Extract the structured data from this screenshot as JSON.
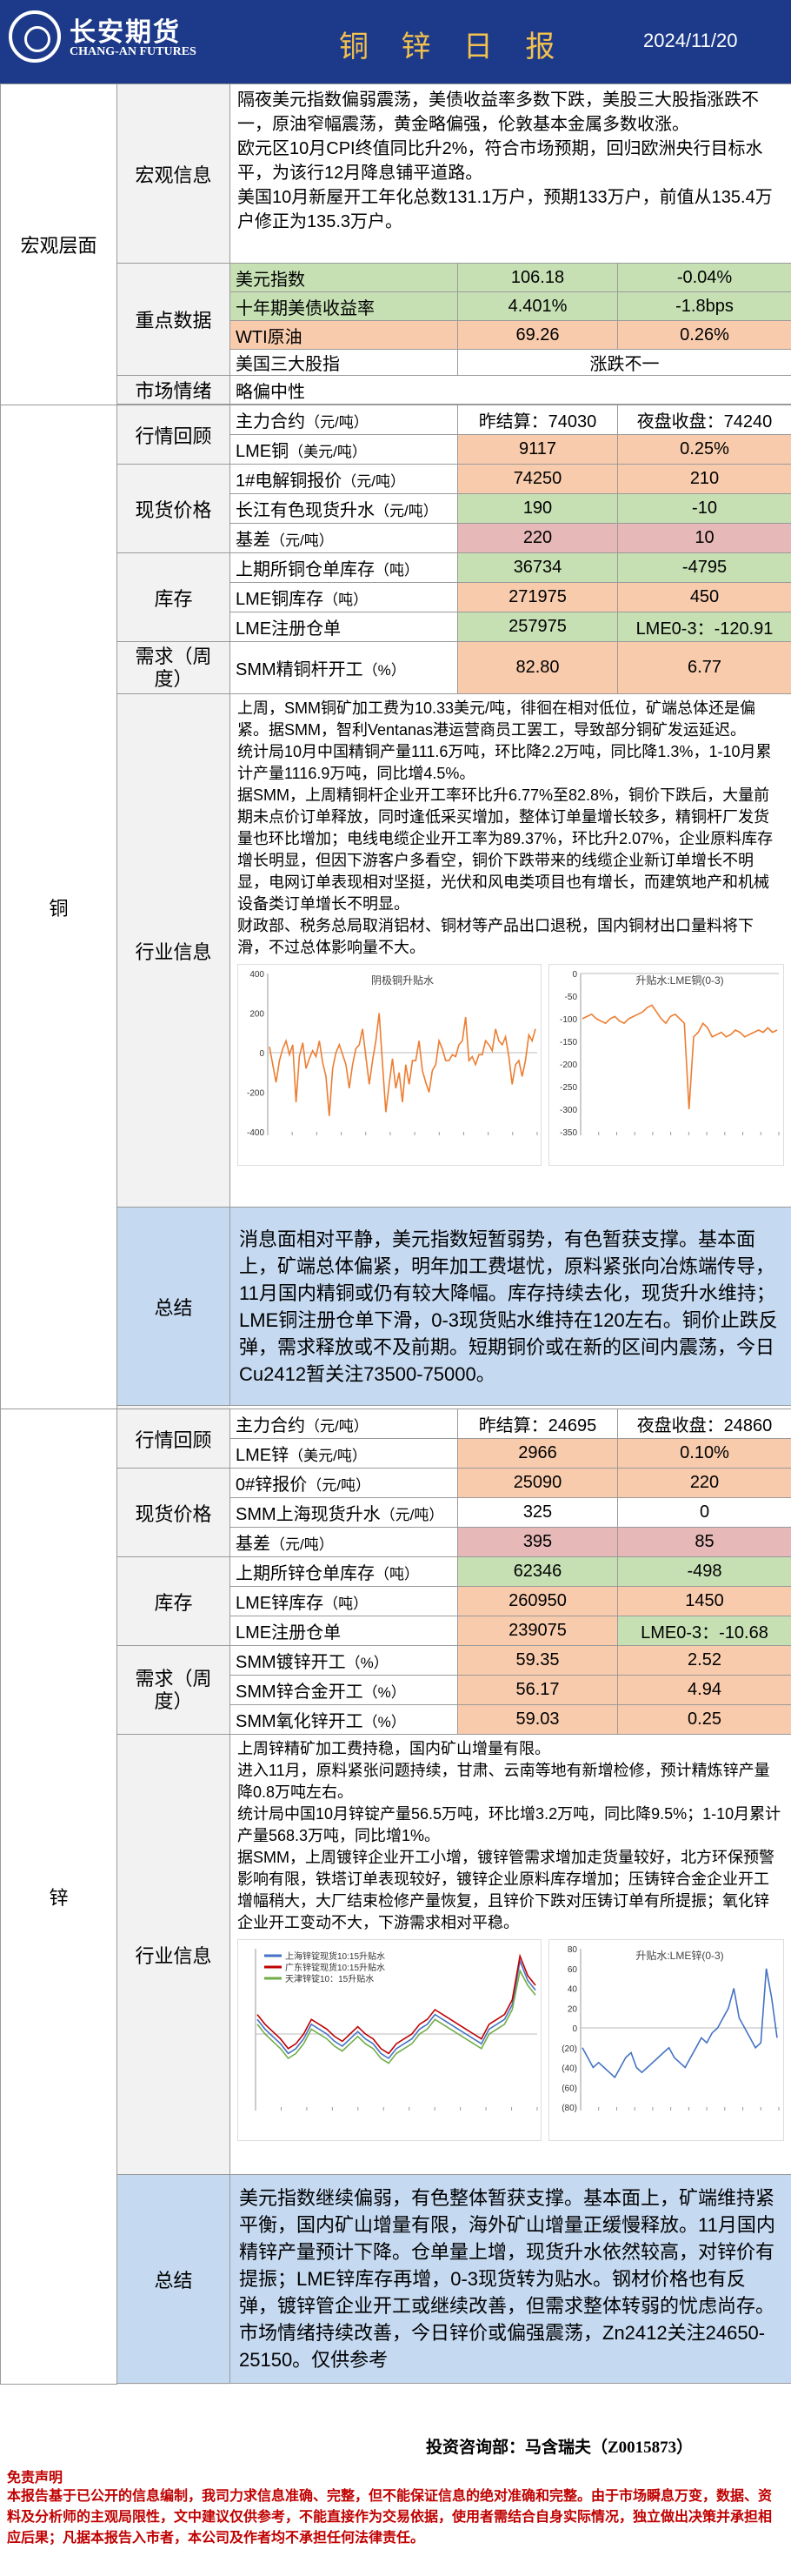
{
  "header": {
    "brand": "长安期货",
    "brand_en": "CHANG-AN FUTURES",
    "title": "铜 锌 日 报",
    "date": "2024/11/20"
  },
  "macro": {
    "section": "宏观层面",
    "info_label": "宏观信息",
    "info": [
      "隔夜美元指数偏弱震荡，美债收益率多数下跌，美股三大股指涨跌不一，原油窄幅震荡，黄金略偏强，伦敦基本金属多数收涨。",
      "欧元区10月CPI终值同比升2%，符合市场预期，回归欧洲央行目标水平，为该行12月降息铺平道路。",
      "美国10月新屋开工年化总数131.1万户，预期133万户，前值从135.4万户修正为135.3万户。"
    ],
    "key_label": "重点数据",
    "key": [
      {
        "name": "美元指数",
        "v1": "106.18",
        "v2": "-0.04%"
      },
      {
        "name": "十年期美债收益率",
        "v1": "4.401%",
        "v2": "-1.8bps"
      },
      {
        "name": "WTI原油",
        "v1": "69.26",
        "v2": "0.26%"
      }
    ],
    "stocks": {
      "name": "美国三大股指",
      "value": "涨跌不一"
    },
    "sentiment_label": "市场情绪",
    "sentiment": "略偏中性"
  },
  "copper": {
    "section": "铜",
    "market_label": "行情回顾",
    "main": {
      "name": "主力合约",
      "unit": "（元/吨）",
      "settle": "昨结算：74030",
      "night": "夜盘收盘：74240"
    },
    "lme": {
      "name": "LME铜",
      "unit": "（美元/吨）",
      "v1": "9117",
      "v2": "0.25%"
    },
    "spot_label": "现货价格",
    "spot": [
      {
        "name": "1#电解铜报价",
        "unit": "（元/吨）",
        "v1": "74250",
        "v2": "210"
      },
      {
        "name": "长江有色现货升水",
        "unit": "（元/吨）",
        "v1": "190",
        "v2": "-10"
      },
      {
        "name": "基差",
        "unit": "（元/吨）",
        "v1": "220",
        "v2": "10"
      }
    ],
    "inv_label": "库存",
    "inv": [
      {
        "name": "上期所铜仓单库存",
        "unit": "（吨）",
        "v1": "36734",
        "v2": "-4795"
      },
      {
        "name": "LME铜库存",
        "unit": "（吨）",
        "v1": "271975",
        "v2": "450"
      },
      {
        "name": "LME注册仓单",
        "unit": "",
        "v1": "257975",
        "v2": "LME0-3：-120.91"
      }
    ],
    "demand_label": "需求（周度）",
    "demand": {
      "name": "SMM精铜杆开工",
      "unit": "（%）",
      "v1": "82.80",
      "v2": "6.77"
    },
    "industry_label": "行业信息",
    "industry": [
      "上周，SMM铜矿加工费为10.33美元/吨，徘徊在相对低位，矿端总体还是偏紧。据SMM，智利Ventanas港运营商员工罢工，导致部分铜矿发运延迟。",
      "统计局10月中国精铜产量111.6万吨，环比降2.2万吨，同比降1.3%，1-10月累计产量1116.9万吨，同比增4.5%。",
      "据SMM，上周精铜杆企业开工率环比升6.77%至82.8%，铜价下跌后，大量前期未点价订单释放，同时逢低采买增加，整体订单量增长较多，精铜杆厂发货量也环比增加；电线电缆企业开工率为89.37%，环比升2.07%，企业原料库存增长明显，但因下游客户多看空，铜价下跌带来的线缆企业新订单增长不明显，电网订单表现相对坚挺，光伏和风电类项目也有增长，而建筑地产和机械设备类订单增长不明显。",
      "财政部、税务总局取消铝材、铜材等产品出口退税，国内铜材出口量料将下滑，不过总体影响量不大。"
    ],
    "chart1_title": "阴极铜升贴水",
    "chart2_title": "升贴水:LME铜(0-3)",
    "summary_label": "总结",
    "summary": "消息面相对平静，美元指数短暂弱势，有色暂获支撑。基本面上，矿端总体偏紧，明年加工费堪忧，原料紧张向冶炼端传导，11月国内精铜或仍有较大降幅。库存持续去化，现货升水维持；LME铜注册仓单下滑，0-3现货贴水维持在120左右。铜价止跌反弹，需求释放或不及前期。短期铜价或在新的区间内震荡，今日Cu2412暂关注73500-75000。"
  },
  "zinc": {
    "section": "锌",
    "market_label": "行情回顾",
    "main": {
      "name": "主力合约",
      "unit": "（元/吨）",
      "settle": "昨结算：24695",
      "night": "夜盘收盘：24860"
    },
    "lme": {
      "name": "LME锌",
      "unit": "（美元/吨）",
      "v1": "2966",
      "v2": "0.10%"
    },
    "spot_label": "现货价格",
    "spot": [
      {
        "name": "0#锌报价",
        "unit": "（元/吨）",
        "v1": "25090",
        "v2": "220"
      },
      {
        "name": "SMM上海现货升水",
        "unit": "（元/吨）",
        "v1": "325",
        "v2": "0"
      },
      {
        "name": "基差",
        "unit": "（元/吨）",
        "v1": "395",
        "v2": "85"
      }
    ],
    "inv_label": "库存",
    "inv": [
      {
        "name": "上期所锌仓单库存",
        "unit": "（吨）",
        "v1": "62346",
        "v2": "-498"
      },
      {
        "name": "LME锌库存",
        "unit": "（吨）",
        "v1": "260950",
        "v2": "1450"
      },
      {
        "name": "LME注册仓单",
        "unit": "",
        "v1": "239075",
        "v2": "LME0-3：-10.68"
      }
    ],
    "demand_label": "需求（周度）",
    "demand": [
      {
        "name": "SMM镀锌开工",
        "unit": "（%）",
        "v1": "59.35",
        "v2": "2.52"
      },
      {
        "name": "SMM锌合金开工",
        "unit": "（%）",
        "v1": "56.17",
        "v2": "4.94"
      },
      {
        "name": "SMM氧化锌开工",
        "unit": "（%）",
        "v1": "59.03",
        "v2": "0.25"
      }
    ],
    "industry_label": "行业信息",
    "industry": [
      "上周锌精矿加工费持稳，国内矿山增量有限。",
      "进入11月，原料紧张问题持续，甘肃、云南等地有新增检修，预计精炼锌产量降0.8万吨左右。",
      "统计局中国10月锌锭产量56.5万吨，环比增3.2万吨，同比降9.5%；1-10月累计产量568.3万吨，同比增1%。",
      "据SMM，上周镀锌企业开工小增，镀锌管需求增加走货量较好，北方环保预警影响有限，铁塔订单表现较好，镀锌企业原料库存增加；压铸锌合金企业开工增幅稍大，大厂结束检修产量恢复，且锌价下跌对压铸订单有所提振；氧化锌企业开工变动不大，下游需求相对平稳。"
    ],
    "chart1_legend": [
      "上海锌锭现货10:15升贴水",
      "广东锌锭现货10:15升贴水",
      "天津锌锭10：15升贴水"
    ],
    "chart2_title": "升贴水:LME锌(0-3)",
    "summary_label": "总结",
    "summary": "美元指数继续偏弱，有色整体暂获支撑。基本面上，矿端维持紧平衡，国内矿山增量有限，海外矿山增量正缓慢释放。11月国内精锌产量预计下降。仓单量上增，现货升水依然较高，对锌价有提振；LME锌库存再增，0-3现货转为贴水。钢材价格也有反弹，镀锌管企业开工或继续改善，但需求整体转弱的忧虑尚存。市场情绪持续改善，今日锌价或偏强震荡，Zn2412关注24650-25150。仅供参考"
  },
  "footer": {
    "consult": "投资咨询部：马含瑞夫（Z0015873）",
    "disc_title": "免责声明",
    "disc": "本报告基于已公开的信息编制，我司力求信息准确、完整，但不能保证信息的绝对准确和完整。由于市场瞬息万变，数据、资料及分析师的主观局限性，文中建议仅供参考，不能直接作为交易依据，使用者需结合自身实际情况，独立做出决策并承担相应后果；凡据本报告入市者，本公司及作者均不承担任何法律责任。"
  },
  "chart_data": [
    {
      "type": "line",
      "title": "阴极铜升贴水",
      "ylim": [
        -400,
        400
      ],
      "yticks": [
        "400",
        "200",
        "0",
        "-200",
        "-400"
      ],
      "series": [
        {
          "color": "#ed7d31",
          "values": [
            30,
            -60,
            -150,
            -40,
            20,
            60,
            -10,
            40,
            -250,
            -20,
            50,
            -80,
            -30,
            10,
            -20,
            60,
            -50,
            -120,
            -320,
            -80,
            0,
            40,
            -10,
            -60,
            -180,
            -60,
            20,
            40,
            120,
            -20,
            -160,
            -40,
            60,
            200,
            -60,
            -300,
            -160,
            -30,
            -180,
            -100,
            -250,
            -60,
            -160,
            -40,
            -40,
            60,
            -90,
            -150,
            -200,
            -90,
            -60,
            60,
            20,
            -40,
            -40,
            -10,
            -20,
            40,
            60,
            180,
            -40,
            -20,
            -60,
            -10,
            -10,
            60,
            40,
            10,
            120,
            60,
            40,
            80,
            -20,
            -160,
            -60,
            -40,
            -120,
            -40,
            90,
            60,
            120
          ]
        }
      ]
    },
    {
      "type": "line",
      "title": "升贴水:LME铜(0-3)",
      "ylim": [
        -350,
        0
      ],
      "yticks": [
        "0",
        "-50",
        "-100",
        "-150",
        "-200",
        "-250",
        "-300",
        "-350"
      ],
      "series": [
        {
          "color": "#ed7d31",
          "values": [
            -100,
            -95,
            -90,
            -100,
            -105,
            -110,
            -100,
            -95,
            -105,
            -110,
            -100,
            -95,
            -90,
            -85,
            -75,
            -70,
            -85,
            -100,
            -110,
            -95,
            -90,
            -100,
            -110,
            -300,
            -140,
            -130,
            -110,
            -120,
            -140,
            -135,
            -130,
            -140,
            -135,
            -125,
            -130,
            -140,
            -135,
            -130,
            -125,
            -130,
            -120,
            -130,
            -125
          ]
        }
      ]
    },
    {
      "type": "line",
      "ylim": [
        -300,
        350
      ],
      "series": [
        {
          "name": "上海锌锭现货10:15升贴水",
          "color": "#4472c4",
          "values": [
            60,
            20,
            -10,
            -40,
            -80,
            -60,
            -20,
            40,
            20,
            0,
            -30,
            -50,
            -20,
            10,
            -20,
            -40,
            -80,
            -100,
            -60,
            -40,
            -20,
            20,
            40,
            80,
            60,
            40,
            20,
            0,
            -20,
            -40,
            20,
            40,
            60,
            120,
            300,
            220,
            180
          ]
        },
        {
          "name": "广东锌锭现货10:15升贴水",
          "color": "#c00000",
          "values": [
            80,
            40,
            10,
            -20,
            -60,
            -40,
            0,
            60,
            40,
            20,
            -10,
            -30,
            0,
            30,
            0,
            -20,
            -60,
            -80,
            -40,
            -20,
            0,
            40,
            60,
            100,
            80,
            60,
            40,
            20,
            0,
            -20,
            40,
            60,
            80,
            140,
            320,
            240,
            200
          ]
        },
        {
          "name": "天津锌锭10：15升贴水",
          "color": "#70ad47",
          "values": [
            40,
            0,
            -30,
            -60,
            -100,
            -80,
            -40,
            20,
            0,
            -20,
            -50,
            -70,
            -40,
            -10,
            -40,
            -60,
            -100,
            -120,
            -80,
            -60,
            -40,
            0,
            20,
            60,
            40,
            20,
            0,
            -20,
            -40,
            -60,
            0,
            20,
            40,
            100,
            260,
            200,
            160
          ]
        }
      ]
    },
    {
      "type": "line",
      "title": "升贴水:LME锌(0-3)",
      "ylim": [
        -80,
        80
      ],
      "yticks": [
        "80",
        "60",
        "40",
        "20",
        "0",
        "(20)",
        "(40)",
        "(60)",
        "(80)"
      ],
      "series": [
        {
          "color": "#4472c4",
          "values": [
            -20,
            -30,
            -40,
            -35,
            -40,
            -45,
            -50,
            -40,
            -30,
            -25,
            -40,
            -45,
            -40,
            -35,
            -30,
            -25,
            -20,
            -30,
            -35,
            -40,
            -30,
            -20,
            -10,
            -15,
            -5,
            0,
            10,
            20,
            40,
            10,
            0,
            -10,
            -20,
            -15,
            60,
            30,
            -10
          ]
        }
      ]
    }
  ]
}
